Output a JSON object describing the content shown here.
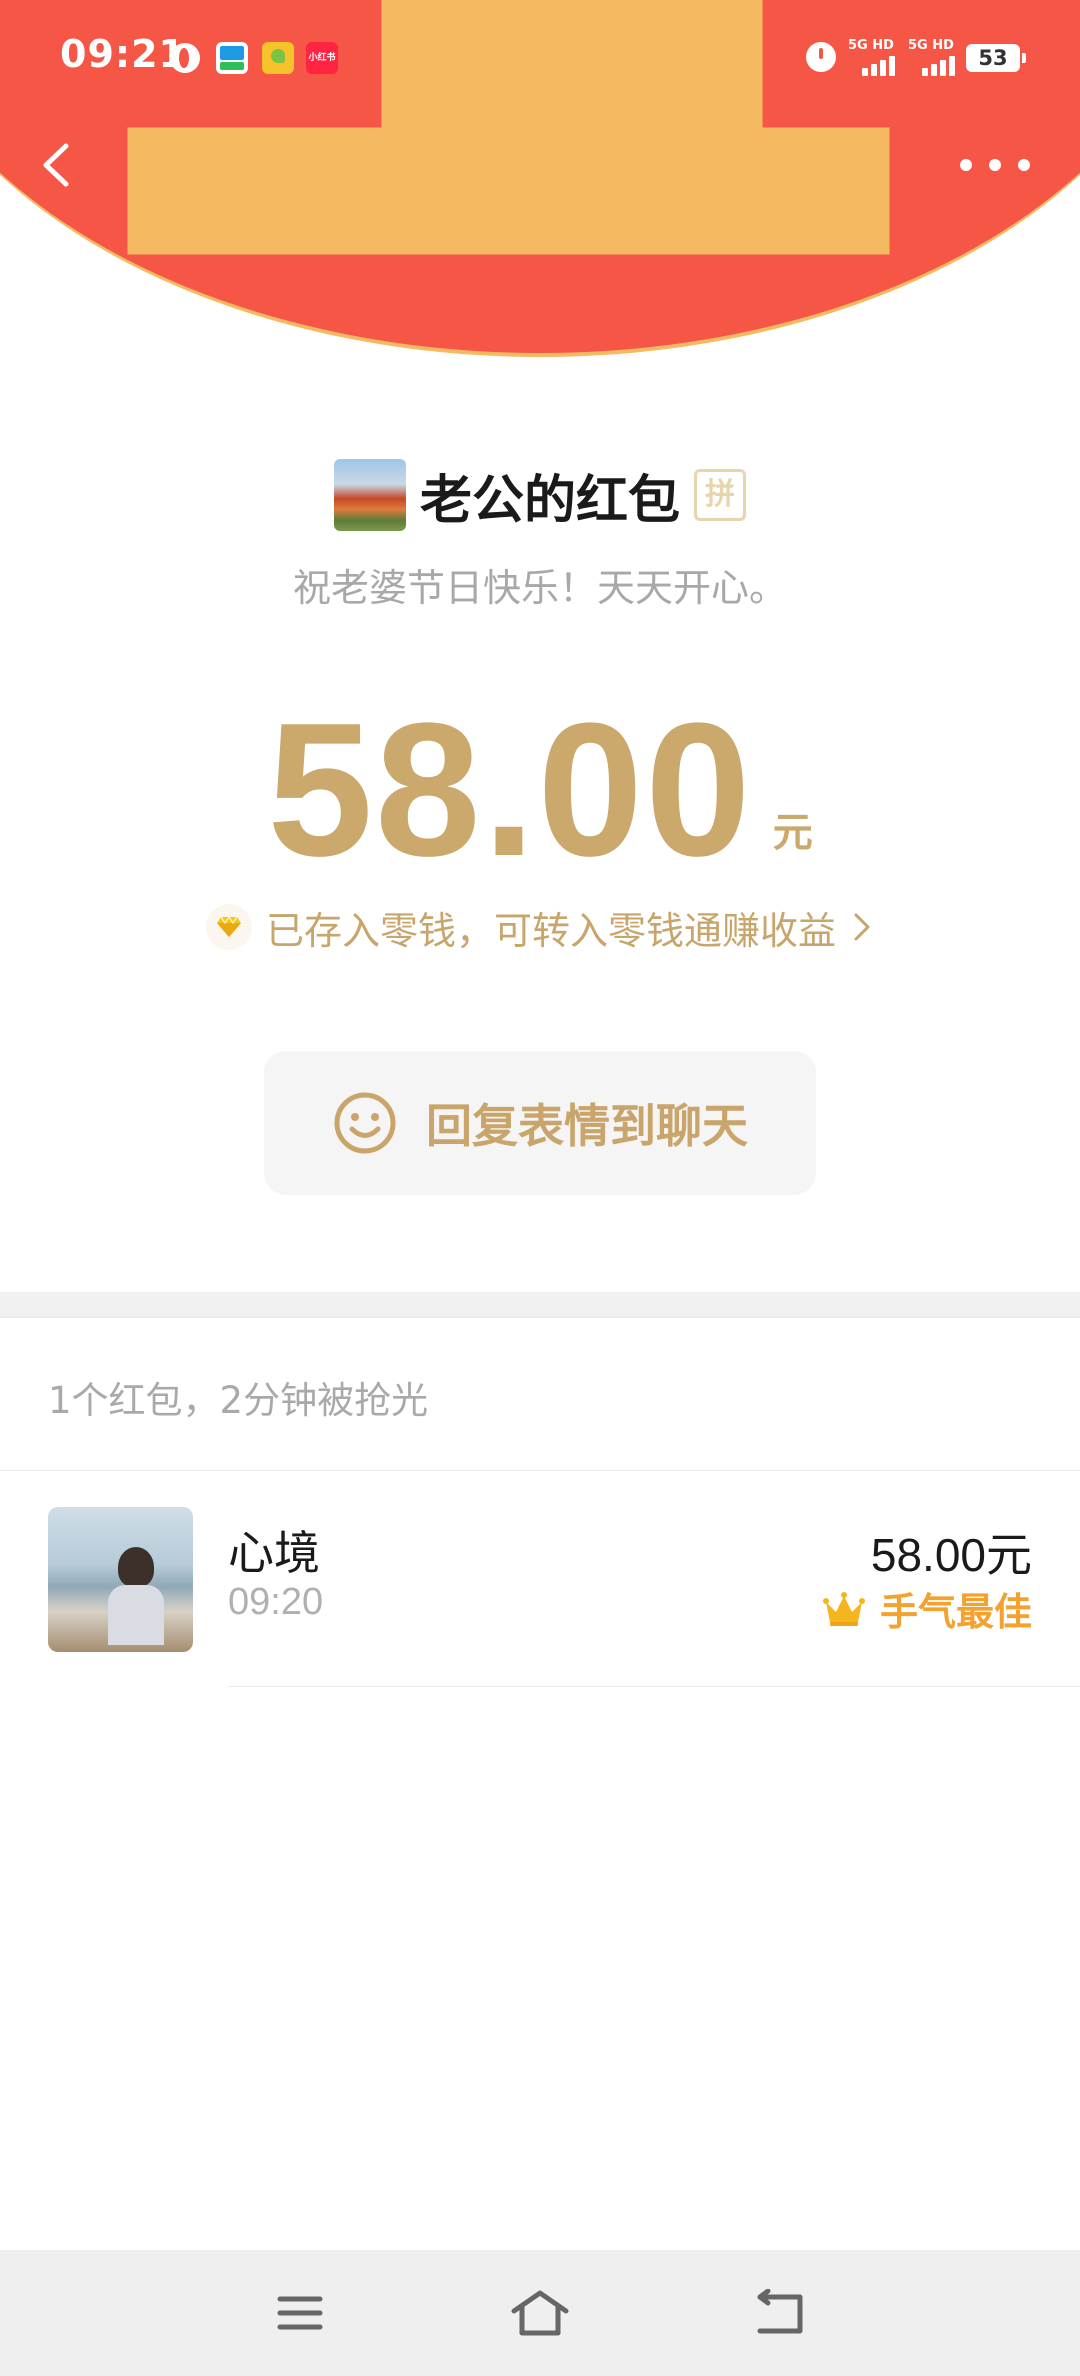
{
  "status_bar": {
    "time": "09:21",
    "app3_label": "小红书",
    "signal1_label": "5G HD",
    "signal2_label": "5G HD",
    "battery": "53"
  },
  "sender": {
    "name": "老公的红包",
    "badge": "拼",
    "greeting": "祝老婆节日快乐！天天开心。"
  },
  "amount": {
    "value": "58.00",
    "unit": "元"
  },
  "change_notice": "已存入零钱，可转入零钱通赚收益",
  "reply_button": "回复表情到聊天",
  "summary": "1个红包，2分钟被抢光",
  "recipients": [
    {
      "name": "心境",
      "time": "09:20",
      "amount": "58.00元",
      "badge": "手气最佳"
    }
  ],
  "colors": {
    "header_red": "#f55646",
    "gold": "#cba86c",
    "best_luck_orange": "#f3a22f"
  }
}
